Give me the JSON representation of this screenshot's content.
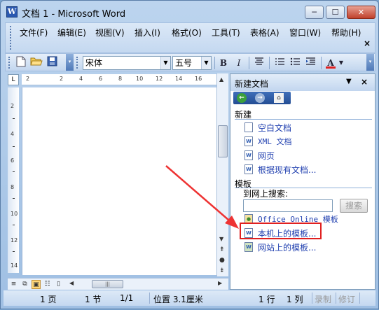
{
  "window": {
    "title": "文档 1 - Microsoft Word",
    "app_icon_letter": "W",
    "minimize_glyph": "─",
    "maximize_glyph": "☐",
    "close_glyph": "✕"
  },
  "menu": {
    "items": [
      "文件(F)",
      "编辑(E)",
      "视图(V)",
      "插入(I)",
      "格式(O)",
      "工具(T)",
      "表格(A)",
      "窗口(W)",
      "帮助(H)"
    ],
    "close_glyph": "×"
  },
  "toolbar": {
    "font_name": "宋体",
    "font_size": "五号",
    "bold": "B",
    "italic": "I",
    "font_color_letter": "A",
    "font_color": "#e02020"
  },
  "ruler": {
    "corner": "L",
    "ticks": [
      "2",
      "2",
      "4",
      "6",
      "8",
      "10",
      "12",
      "14",
      "16"
    ],
    "vticks": [
      "2",
      "4",
      "6",
      "8",
      "10",
      "12",
      "14"
    ]
  },
  "task_pane": {
    "title": "新建文档",
    "section_new": "新建",
    "new_items": [
      {
        "label": "空白文档",
        "icon": "blank-doc-icon"
      },
      {
        "label": "XML 文档",
        "icon": "xml-doc-icon"
      },
      {
        "label": "网页",
        "icon": "web-page-icon"
      },
      {
        "label": "根据现有文档...",
        "icon": "existing-doc-icon"
      }
    ],
    "section_templates": "模板",
    "search_label": "到网上搜索:",
    "search_value": "",
    "search_button": "搜索",
    "template_items": [
      {
        "label": "Office Online 模板",
        "icon": "office-online-icon"
      },
      {
        "label": "本机上的模板...",
        "icon": "local-template-icon"
      },
      {
        "label": "网站上的模板...",
        "icon": "website-template-icon"
      }
    ]
  },
  "status": {
    "page": "1 页",
    "section": "1 节",
    "page_of": "1/1",
    "position": "位置 3.1厘米",
    "line": "1 行",
    "column": "1 列",
    "rec": "录制",
    "trk": "修订"
  },
  "annotation": {
    "highlight_color": "#e02020"
  }
}
